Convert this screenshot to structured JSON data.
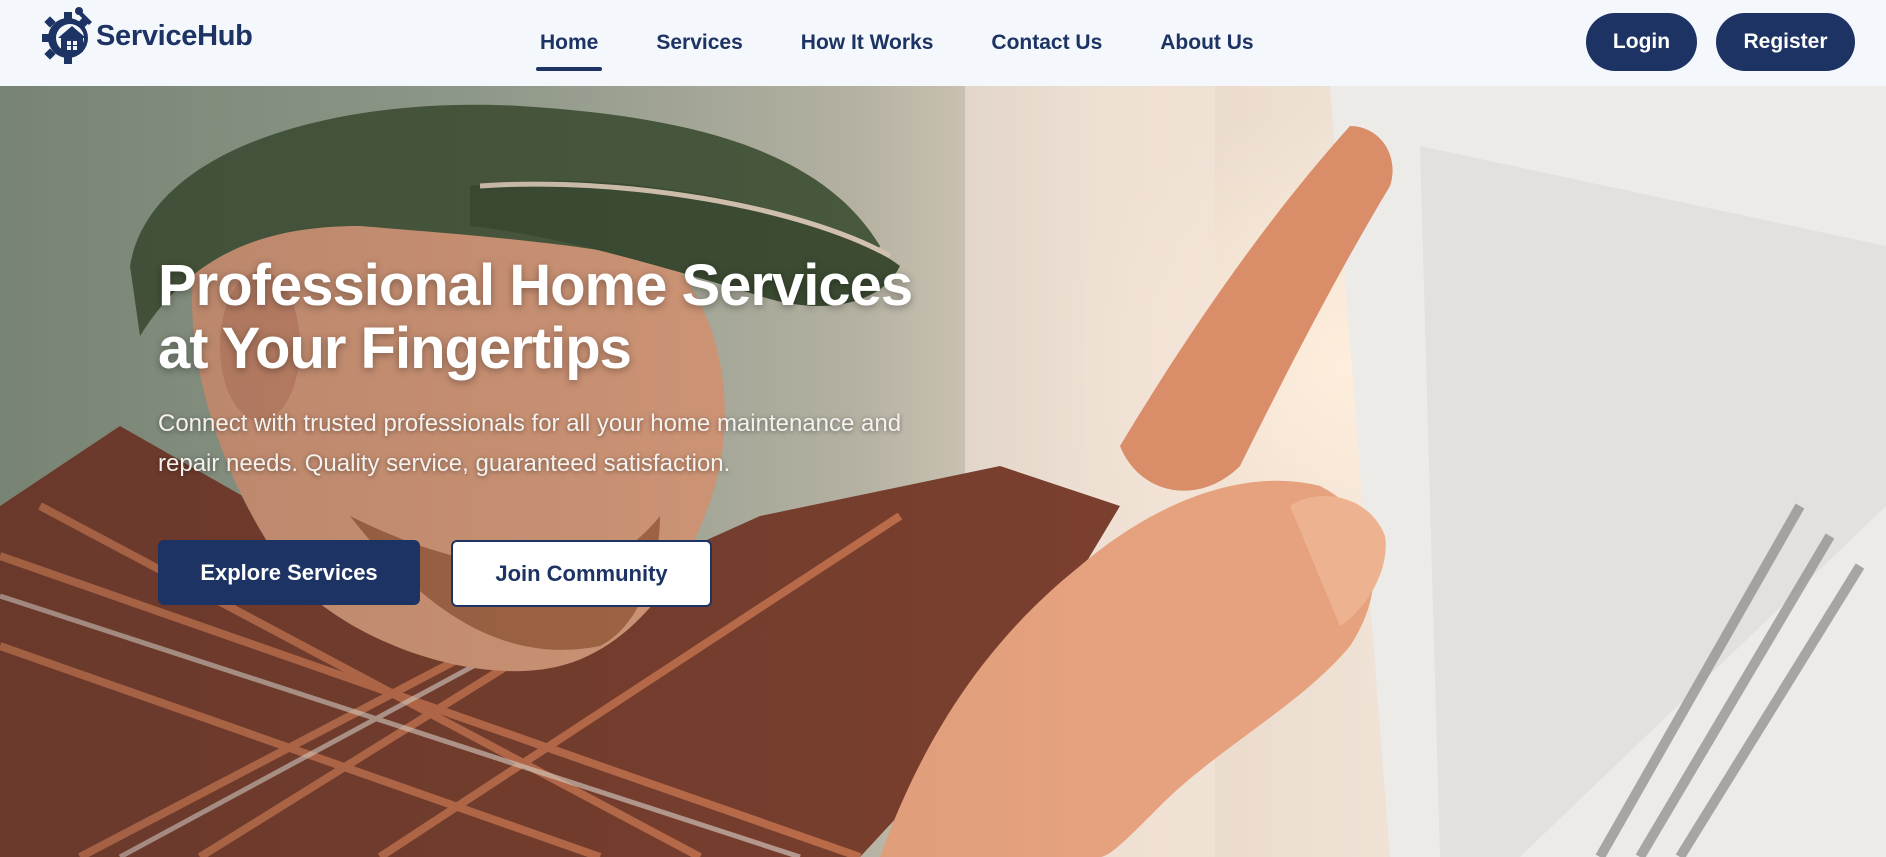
{
  "brand": {
    "name": "ServiceHub",
    "logo_icon": "gear-house-icon",
    "color": "#1c3363"
  },
  "nav": {
    "items": [
      {
        "label": "Home",
        "active": true
      },
      {
        "label": "Services",
        "active": false
      },
      {
        "label": "How It Works",
        "active": false
      },
      {
        "label": "Contact Us",
        "active": false
      },
      {
        "label": "About Us",
        "active": false
      }
    ]
  },
  "auth": {
    "login_label": "Login",
    "register_label": "Register"
  },
  "hero": {
    "title_line1": "Professional Home Services",
    "title_line2": "at Your Fingertips",
    "subtitle_line1": "Connect with trusted professionals for all your home maintenance and",
    "subtitle_line2": "repair needs. Quality service, guaranteed satisfaction.",
    "primary_button": "Explore Services",
    "secondary_button": "Join Community"
  },
  "colors": {
    "accent": "#1c3363",
    "header_bg": "#f4f7fb",
    "white": "#ffffff"
  }
}
